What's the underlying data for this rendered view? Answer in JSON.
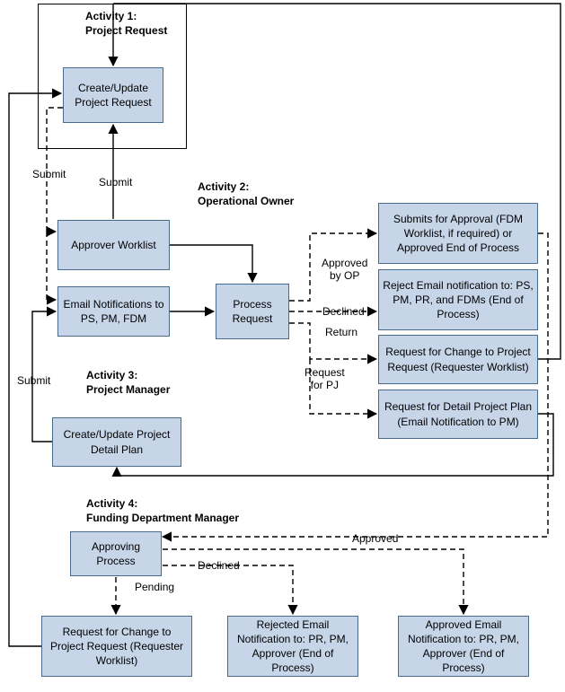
{
  "activity1": {
    "title": "Activity 1:\nProject Request",
    "box1": "Create/Update\nProject Request"
  },
  "activity2": {
    "title": "Activity 2:\nOperational Owner",
    "approver": "Approver Worklist",
    "email": "Email Notifications\nto PS, PM, FDM",
    "process": "Process\nRequest",
    "out_approve": "Submits for Approval\n(FDM Worklist, if required) or\nApproved\nEnd of Process",
    "out_reject": "Reject\nEmail notification to:\nPS, PM, PR, and FDMs\n(End of Process)",
    "out_return": "Request for Change to\nProject Request\n(Requester Worklist)",
    "out_reqpj": "Request for Detail Project\nPlan (Email Notification\nto PM)"
  },
  "activity3": {
    "title": "Activity 3:\nProject Manager",
    "box": "Create/Update\nProject Detail Plan"
  },
  "activity4": {
    "title": "Activity 4:\nFunding Department Manager",
    "approving": "Approving\nProcess",
    "pending": "Request for Change to\nProject Request\n(Requester Worklist)",
    "rejected": "Rejected\nEmail Notification to:\nPR, PM, Approver\n(End of Process)",
    "approved": "Approved\nEmail Notification to:\nPR, PM, Approver\n(End of Process)"
  },
  "labels": {
    "submit1": "Submit",
    "submit2": "Submit",
    "submit3": "Submit",
    "approved_by_op": "Approved\nby OP",
    "declined1": "Declined",
    "return": "Return",
    "request_for_pj": "Request\nfor PJ",
    "approved": "Approved",
    "declined2": "Declined",
    "pending": "Pending"
  }
}
